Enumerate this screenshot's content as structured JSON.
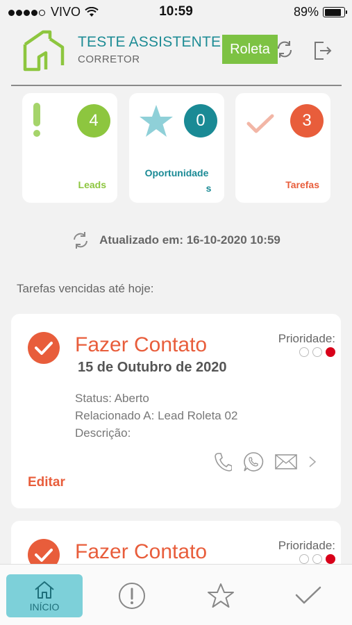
{
  "status_bar": {
    "carrier": "VIVO",
    "time": "10:59",
    "battery": "89%"
  },
  "header": {
    "user_name": "TESTE ASSISTENTE",
    "user_role": "CORRETOR",
    "roleta_label": "Roleta"
  },
  "stats": [
    {
      "label": "Leads",
      "count": "4",
      "color": "#8dc63f"
    },
    {
      "label_line1": "Oportunidade",
      "label_line2": "s",
      "count": "0",
      "color": "#1a8a95"
    },
    {
      "label": "Tarefas",
      "count": "3",
      "color": "#e85d3b"
    }
  ],
  "updated_text": "Atualizado em: 16-10-2020 10:59",
  "section_title": "Tarefas vencidas até hoje:",
  "tasks": [
    {
      "title": "Fazer Contato",
      "date": "15 de Outubro de 2020",
      "priority_label": "Prioridade:",
      "priority_level": 3,
      "status": "Status: Aberto",
      "related": "Relacionado A: Lead Roleta 02",
      "description": "Descrição:",
      "edit_label": "Editar"
    },
    {
      "title": "Fazer Contato",
      "priority_label": "Prioridade:",
      "priority_level": 3
    }
  ],
  "bottom_nav": {
    "home_label": "INÍCIO",
    "icons": [
      "home-icon",
      "alert-icon",
      "star-icon",
      "check-icon"
    ]
  },
  "colors": {
    "teal": "#1e8c95",
    "green": "#7dc243",
    "orange": "#e85d3b",
    "red": "#d8001a"
  }
}
